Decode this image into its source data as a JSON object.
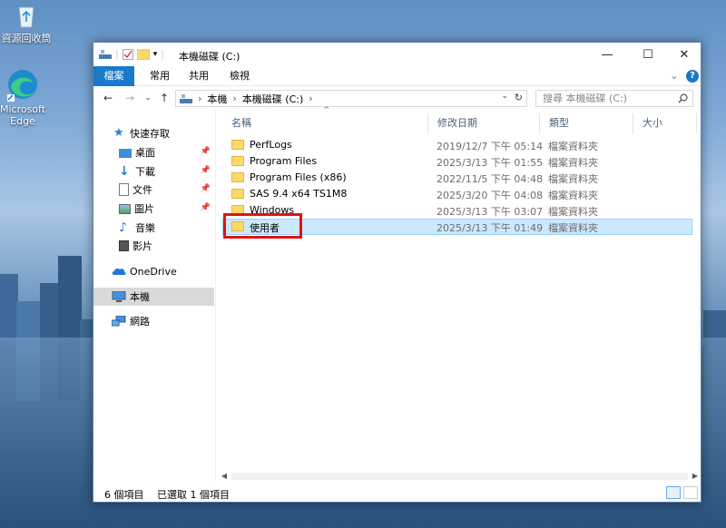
{
  "desktop": {
    "icons": [
      {
        "label": "資源回收筒",
        "icon": "recycle-bin-icon"
      },
      {
        "label": "Microsoft Edge",
        "icon": "edge-icon"
      }
    ]
  },
  "window": {
    "title": "本機磁碟 (C:)",
    "controls": {
      "minimize": "—",
      "maximize": "☐",
      "close": "✕"
    }
  },
  "ribbon": {
    "tabs": [
      "檔案",
      "常用",
      "共用",
      "檢視"
    ],
    "expand": "⌄",
    "help": "?"
  },
  "address": {
    "path": [
      "本機",
      "本機磁碟 (C:)"
    ],
    "search_placeholder": "搜尋 本機磁碟 (C:)"
  },
  "nav": {
    "quick_access": "快速存取",
    "pinned": [
      {
        "label": "桌面",
        "icon": "desktop-icon"
      },
      {
        "label": "下載",
        "icon": "download-icon"
      },
      {
        "label": "文件",
        "icon": "document-icon"
      },
      {
        "label": "圖片",
        "icon": "picture-icon"
      }
    ],
    "unpinned": [
      {
        "label": "音樂",
        "icon": "music-icon"
      },
      {
        "label": "影片",
        "icon": "video-icon"
      }
    ],
    "onedrive": "OneDrive",
    "this_pc": "本機",
    "network": "網路"
  },
  "columns": {
    "name": "名稱",
    "date": "修改日期",
    "type": "類型",
    "size": "大小"
  },
  "files": [
    {
      "name": "PerfLogs",
      "date": "2019/12/7 下午 05:14",
      "type": "檔案資料夾"
    },
    {
      "name": "Program Files",
      "date": "2025/3/13 下午 01:55",
      "type": "檔案資料夾"
    },
    {
      "name": "Program Files (x86)",
      "date": "2022/11/5 下午 04:48",
      "type": "檔案資料夾"
    },
    {
      "name": "SAS 9.4 x64 TS1M8",
      "date": "2025/3/20 下午 04:08",
      "type": "檔案資料夾"
    },
    {
      "name": "Windows",
      "date": "2025/3/13 下午 03:07",
      "type": "檔案資料夾"
    },
    {
      "name": "使用者",
      "date": "2025/3/13 下午 01:49",
      "type": "檔案資料夾"
    }
  ],
  "status": {
    "count": "6 個項目",
    "selected": "已選取 1 個項目"
  },
  "colors": {
    "accent": "#1979ca",
    "selection": "#cce8ff",
    "highlight": "#e0140f"
  }
}
